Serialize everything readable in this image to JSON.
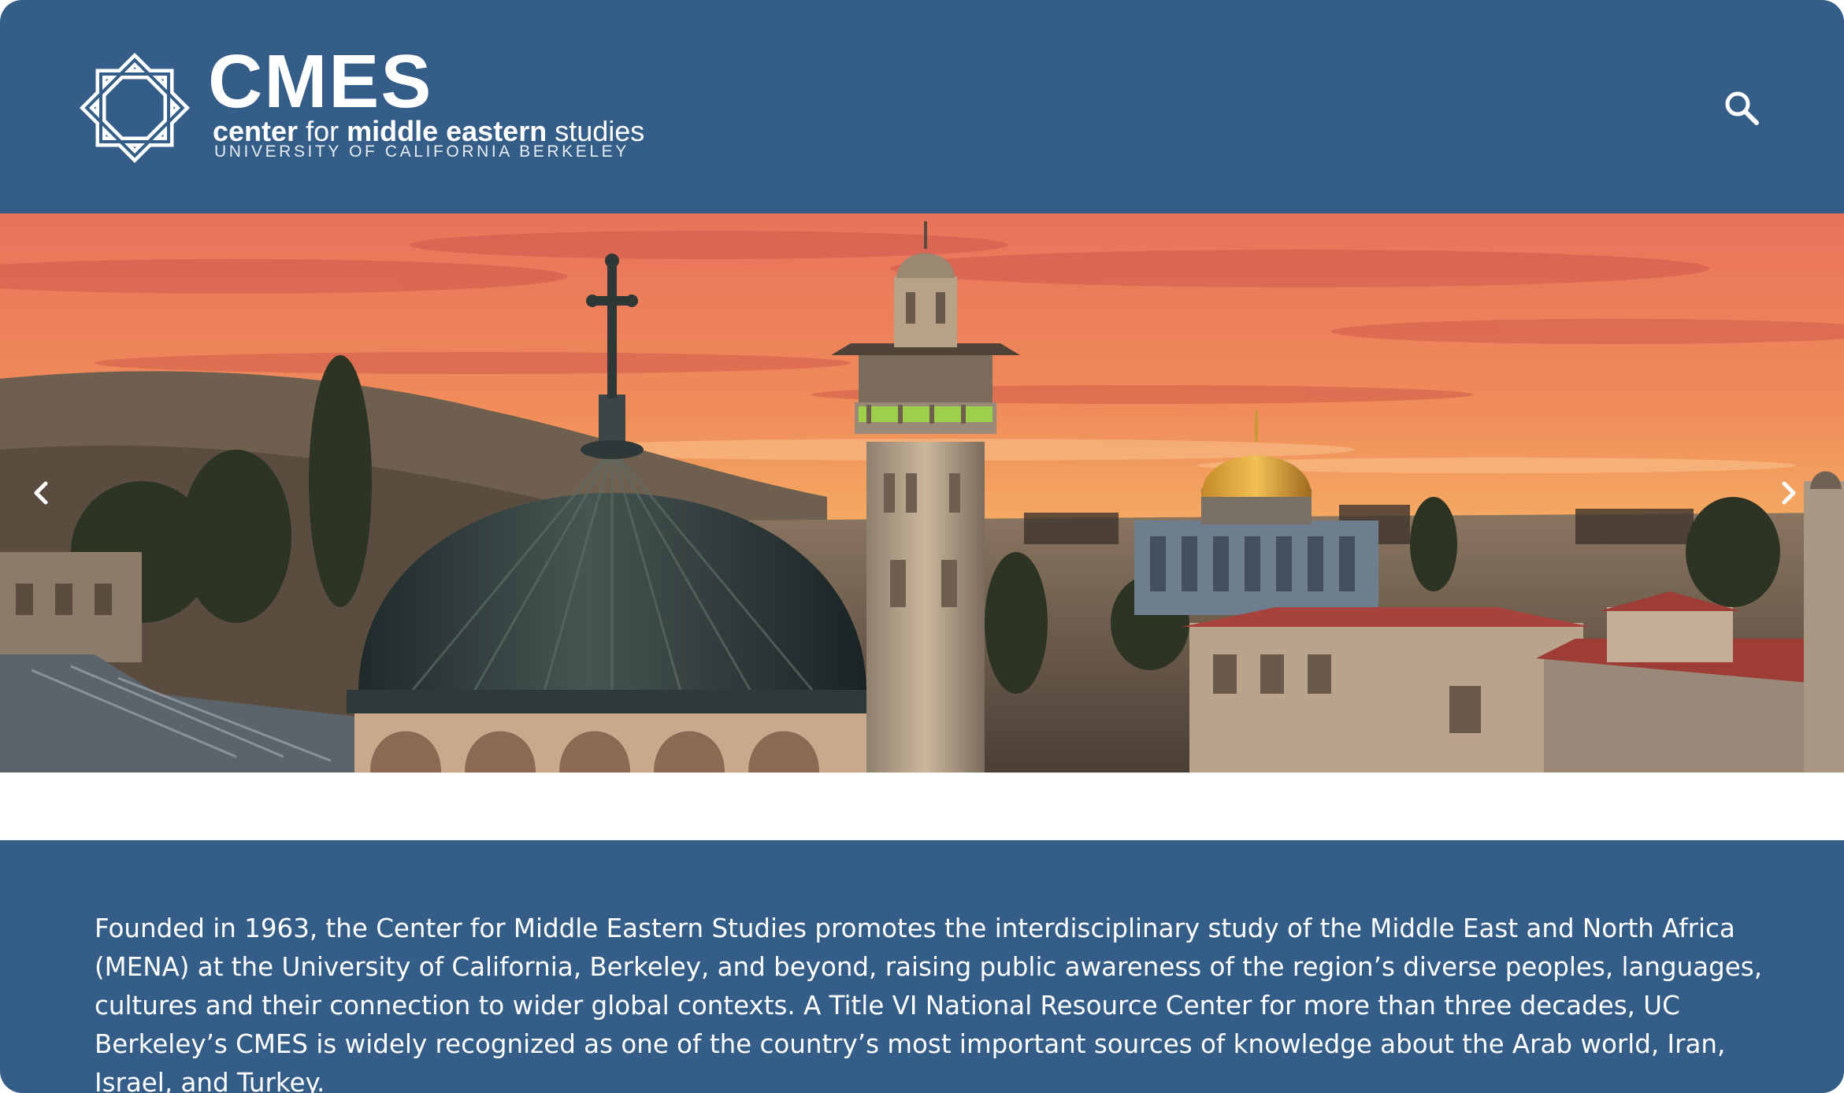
{
  "header": {
    "logo": {
      "acronym": "CMES",
      "line1_prefix": "center",
      "line1_for": "for",
      "line1_bold": "middle eastern",
      "line1_suffix": "studies",
      "line2": "UNIVERSITY OF CALIFORNIA BERKELEY"
    },
    "search_icon": "search-icon"
  },
  "hero": {
    "prev_icon": "chevron-left-icon",
    "next_icon": "chevron-right-icon"
  },
  "intro": {
    "text": "Founded in 1963, the Center for Middle Eastern Studies promotes the interdisciplinary study of the Middle East and North Africa (MENA) at the University of California, Berkeley, and beyond, raising public awareness of the region’s diverse peoples, languages, cultures and their connection to wider global contexts. A Title VI National Resource Center for more than three decades, UC Berkeley’s CMES is widely recognized as one of the country’s most important sources of knowledge about the Arab world, Iran, Israel, and Turkey."
  },
  "colors": {
    "brand_blue": "#345d87",
    "white": "#ffffff"
  }
}
